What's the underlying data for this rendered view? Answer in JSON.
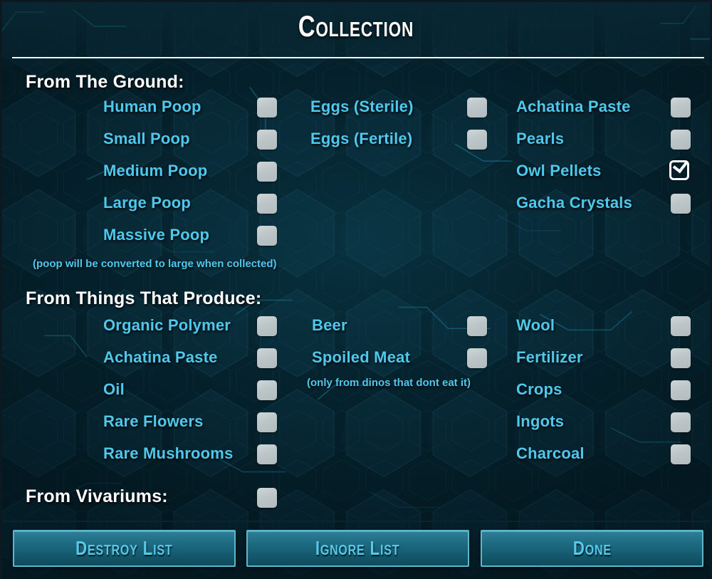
{
  "window": {
    "title": "Collection",
    "accent_cyan": "#4fc8ec",
    "background": "#05222d",
    "button_teal": "#1d6a80",
    "checkbox_gray": "#bcc5c7"
  },
  "sections": [
    {
      "id": "from-the-ground",
      "heading": "From The Ground:",
      "note": "(poop will be converted to large when collected)",
      "columns": [
        {
          "id": "ground-col-1",
          "items": [
            {
              "label": "Human Poop",
              "checked": false
            },
            {
              "label": "Small Poop",
              "checked": false
            },
            {
              "label": "Medium Poop",
              "checked": false
            },
            {
              "label": "Large Poop",
              "checked": false
            },
            {
              "label": "Massive Poop",
              "checked": false
            }
          ]
        },
        {
          "id": "ground-col-2",
          "items": [
            {
              "label": "Eggs (Sterile)",
              "checked": false
            },
            {
              "label": "Eggs (Fertile)",
              "checked": false
            }
          ]
        },
        {
          "id": "ground-col-3",
          "items": [
            {
              "label": "Achatina Paste",
              "checked": false
            },
            {
              "label": "Pearls",
              "checked": false
            },
            {
              "label": "Owl Pellets",
              "checked": true
            },
            {
              "label": "Gacha Crystals",
              "checked": false
            }
          ]
        }
      ]
    },
    {
      "id": "from-things-that-produce",
      "heading": "From Things That Produce:",
      "note": "(only from dinos that dont eat it)",
      "columns": [
        {
          "id": "produce-col-1",
          "items": [
            {
              "label": "Organic Polymer",
              "checked": false
            },
            {
              "label": "Achatina Paste",
              "checked": false
            },
            {
              "label": "Oil",
              "checked": false
            },
            {
              "label": "Rare Flowers",
              "checked": false
            },
            {
              "label": "Rare Mushrooms",
              "checked": false
            }
          ]
        },
        {
          "id": "produce-col-2",
          "items": [
            {
              "label": "Beer",
              "checked": false
            },
            {
              "label": "Spoiled Meat",
              "checked": false
            }
          ]
        },
        {
          "id": "produce-col-3",
          "items": [
            {
              "label": "Wool",
              "checked": false
            },
            {
              "label": "Fertilizer",
              "checked": false
            },
            {
              "label": "Crops",
              "checked": false
            },
            {
              "label": "Ingots",
              "checked": false
            },
            {
              "label": "Charcoal",
              "checked": false
            }
          ]
        }
      ]
    },
    {
      "id": "from-vivariums",
      "heading": "From Vivariums:",
      "checked": false
    }
  ],
  "footer": {
    "destroy_list_label": "Destroy List",
    "ignore_list_label": "Ignore List",
    "done_label": "Done"
  }
}
